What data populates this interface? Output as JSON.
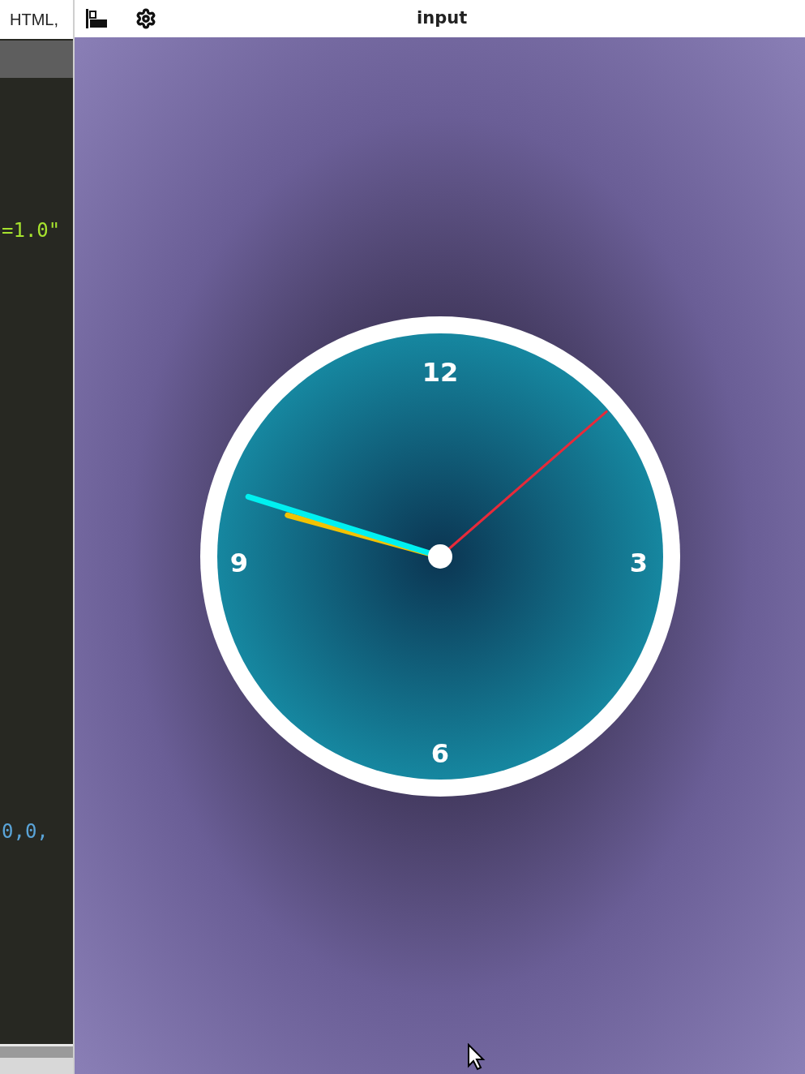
{
  "editor": {
    "tab": "HTML,",
    "code_lines": [
      {
        "text": "=1.0\"",
        "kind": "string"
      },
      {
        "text": "0,0,",
        "kind": "number"
      }
    ]
  },
  "preview": {
    "title": "input",
    "clock": {
      "numerals": [
        {
          "text": "12"
        },
        {
          "text": "3"
        },
        {
          "text": "6"
        },
        {
          "text": "9"
        }
      ],
      "hands": [
        {
          "kind": "hour"
        },
        {
          "kind": "minute"
        },
        {
          "kind": "second"
        }
      ]
    }
  }
}
